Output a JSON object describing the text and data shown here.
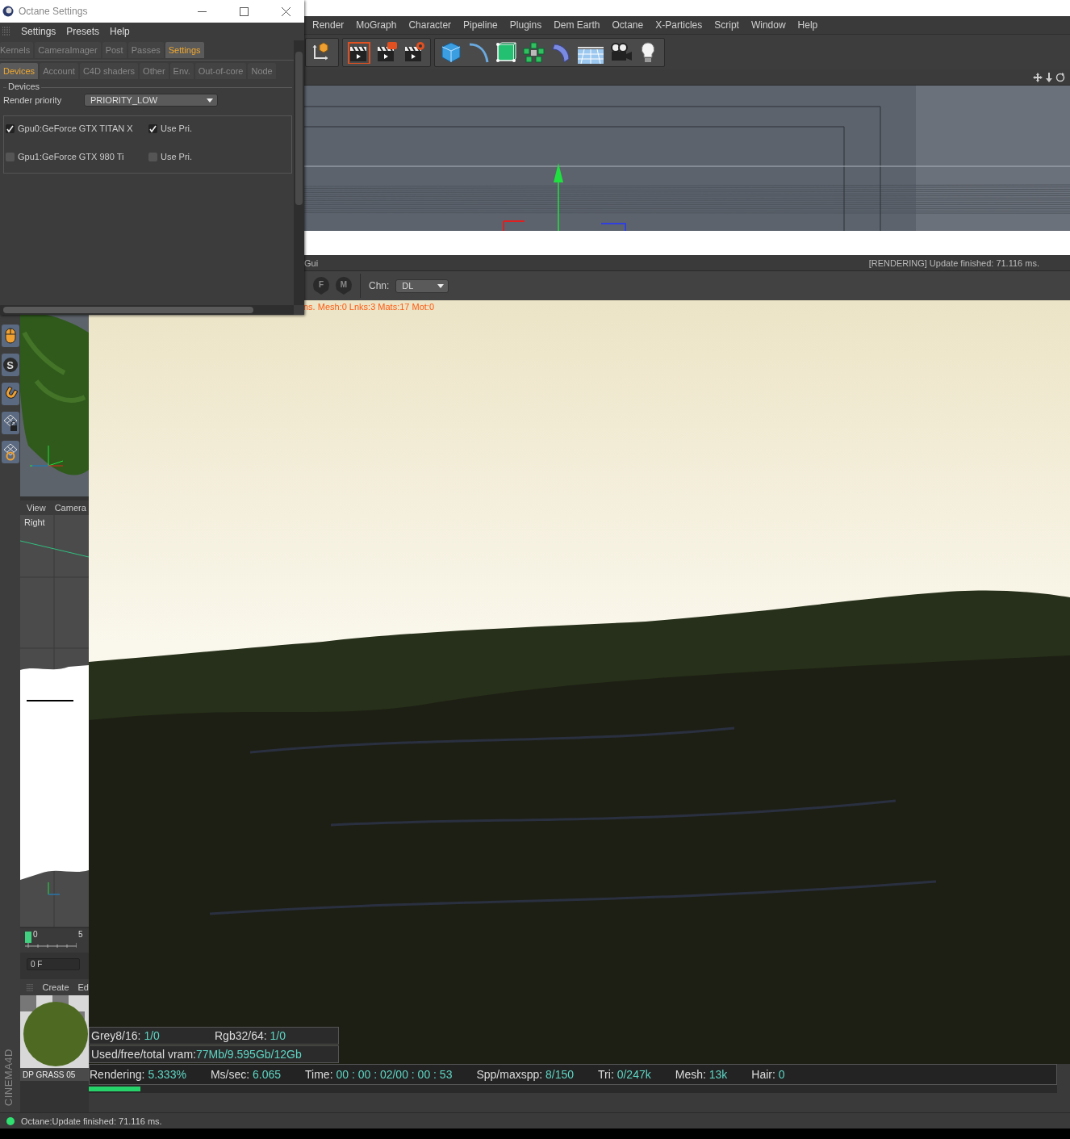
{
  "dialog": {
    "title": "Octane Settings",
    "menu": [
      "Settings",
      "Presets",
      "Help"
    ],
    "tabs": [
      {
        "label": "Kernels",
        "selected": false
      },
      {
        "label": "CameraImager",
        "selected": false
      },
      {
        "label": "Post",
        "selected": false
      },
      {
        "label": "Passes",
        "selected": false
      },
      {
        "label": "Settings",
        "selected": true
      }
    ],
    "subtabs": [
      {
        "label": "Devices",
        "selected": true
      },
      {
        "label": "Account",
        "selected": false
      },
      {
        "label": "C4D shaders",
        "selected": false
      },
      {
        "label": "Other",
        "selected": false
      },
      {
        "label": "Env.",
        "selected": false
      },
      {
        "label": "Out-of-core",
        "selected": false
      },
      {
        "label": "Node",
        "selected": false
      }
    ],
    "group_title": "Devices",
    "render_priority": {
      "label": "Render priority",
      "value": "PRIORITY_LOW"
    },
    "devices": [
      {
        "name": "Gpu0:GeForce GTX TITAN X",
        "checked": true,
        "use_pri_label": "Use Pri.",
        "use_pri": true
      },
      {
        "name": "Gpu1:GeForce GTX 980 Ti",
        "checked": false,
        "use_pri_label": "Use Pri.",
        "use_pri": false
      }
    ]
  },
  "menu_bar": [
    "Render",
    "MoGraph",
    "Character",
    "Pipeline",
    "Plugins",
    "Dem Earth",
    "Octane",
    "X-Particles",
    "Script",
    "Window",
    "Help"
  ],
  "viewer": {
    "title": "Gui",
    "status": "[RENDERING] Update finished: 71.116 ms.",
    "pins": [
      "F",
      "M"
    ],
    "channel_label": "Chn:",
    "channel": "DL",
    "info": "ns. Mesh:0 Lnks:3 Mats:17 Mot:0",
    "buffers": [
      {
        "label": "Grey8/16:",
        "value": "1/0"
      },
      {
        "label": "Rgb32/64:",
        "value": "1/0"
      }
    ],
    "vram": {
      "label": "Used/free/total vram:",
      "value": "77Mb/9.595Gb/12Gb"
    },
    "stats": [
      {
        "label": "Rendering:",
        "value": "5.333%"
      },
      {
        "label": "Ms/sec:",
        "value": "6.065"
      },
      {
        "label": "Time:",
        "value": "00 : 00 : 02/00 : 00 : 53"
      },
      {
        "label": "Spp/maxspp:",
        "value": "8/150"
      },
      {
        "label": "Tri:",
        "value": "0/247k"
      },
      {
        "label": "Mesh:",
        "value": "13k"
      },
      {
        "label": "Hair:",
        "value": "0"
      }
    ],
    "progress": {
      "level": 0.053
    }
  },
  "left_panel": {
    "tool_letter": "S",
    "view_menu": [
      "View",
      "Camera"
    ],
    "view_name": "Right",
    "timeline": [
      "0",
      "5"
    ],
    "frame": "0 F",
    "material_menu": [
      "Create",
      "Ed"
    ],
    "material_name": "DP GRASS 05",
    "logo": "CINEMA4D"
  },
  "status_bar": "Octane:Update finished: 71.116 ms."
}
